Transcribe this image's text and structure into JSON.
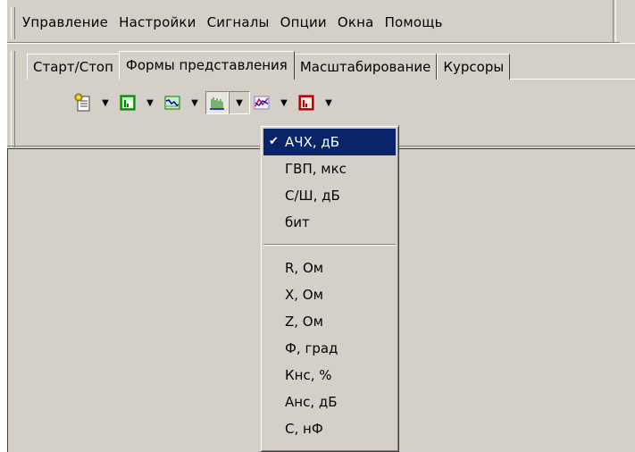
{
  "menubar": {
    "items": [
      "Управление",
      "Настройки",
      "Сигналы",
      "Опции",
      "Окна",
      "Помощь"
    ]
  },
  "tabs": [
    {
      "label": "Старт/Стоп",
      "active": false
    },
    {
      "label": "Формы представления",
      "active": true
    },
    {
      "label": "Масштабирование",
      "active": false
    },
    {
      "label": "Курсоры",
      "active": false
    }
  ],
  "toolbar": {
    "buttons": [
      {
        "icon": "settings-document-icon"
      },
      {
        "icon": "green-bar-chart-icon"
      },
      {
        "icon": "waveform-icon"
      },
      {
        "icon": "spectrum-bars-icon",
        "pressed": true
      },
      {
        "icon": "multi-graph-icon"
      },
      {
        "icon": "red-bar-chart-icon"
      }
    ]
  },
  "dropdown": {
    "group1": [
      {
        "label": "АЧХ, дБ",
        "checked": true,
        "selected": true
      },
      {
        "label": "ГВП, мкс"
      },
      {
        "label": "С/Ш, дБ"
      },
      {
        "label": "бит"
      }
    ],
    "group2": [
      {
        "label": "R, Ом"
      },
      {
        "label": "X, Ом"
      },
      {
        "label": "Z, Ом"
      },
      {
        "label": "Ф, град"
      },
      {
        "label": "Кнс, %"
      },
      {
        "label": "Анс, дБ"
      },
      {
        "label": "С, нФ"
      }
    ],
    "check_glyph": "✔"
  },
  "colors": {
    "face": "#d4d0c8",
    "selection": "#0a246a"
  }
}
